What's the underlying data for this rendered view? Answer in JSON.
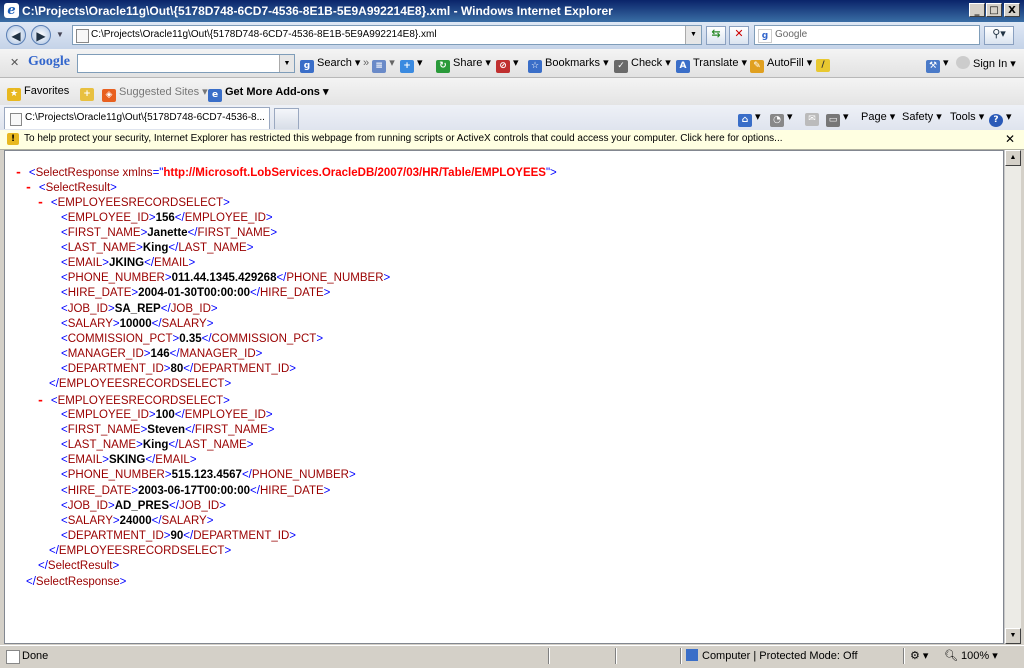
{
  "window": {
    "title": "C:\\Projects\\Oracle11g\\Out\\{5178D748-6CD7-4536-8E1B-5E9A992214E8}.xml - Windows Internet Explorer",
    "minimize": "_",
    "maximize": "□",
    "close": "X"
  },
  "address_bar": {
    "url": "C:\\Projects\\Oracle11g\\Out\\{5178D748-6CD7-4536-8E1B-5E9A992214E8}.xml",
    "search_placeholder": "Google"
  },
  "google_toolbar": {
    "brand": "Google",
    "items": [
      "Search",
      "Share",
      "Bookmarks",
      "Check",
      "Translate",
      "AutoFill"
    ],
    "sign_in": "Sign In"
  },
  "favorites_bar": {
    "favorites": "Favorites",
    "suggested_sites": "Suggested Sites",
    "get_addons": "Get More Add-ons"
  },
  "tab": {
    "title": "C:\\Projects\\Oracle11g\\Out\\{5178D748-6CD7-4536-8..."
  },
  "command_bar": {
    "page": "Page",
    "safety": "Safety",
    "tools": "Tools"
  },
  "info_bar": {
    "message": "To help protect your security, Internet Explorer has restricted this webpage from running scripts or ActiveX controls that could access your computer. Click here for options..."
  },
  "xml": {
    "root_tag": "SelectResponse",
    "root_attr_name": "xmlns",
    "root_attr_value": "http://Microsoft.LobServices.OracleDB/2007/03/HR/Table/EMPLOYEES",
    "result_tag": "SelectResult",
    "record_tag": "EMPLOYEESRECORDSELECT",
    "records": [
      {
        "fields": [
          {
            "tag": "EMPLOYEE_ID",
            "value": "156"
          },
          {
            "tag": "FIRST_NAME",
            "value": "Janette"
          },
          {
            "tag": "LAST_NAME",
            "value": "King"
          },
          {
            "tag": "EMAIL",
            "value": "JKING"
          },
          {
            "tag": "PHONE_NUMBER",
            "value": "011.44.1345.429268"
          },
          {
            "tag": "HIRE_DATE",
            "value": "2004-01-30T00:00:00"
          },
          {
            "tag": "JOB_ID",
            "value": "SA_REP"
          },
          {
            "tag": "SALARY",
            "value": "10000"
          },
          {
            "tag": "COMMISSION_PCT",
            "value": "0.35"
          },
          {
            "tag": "MANAGER_ID",
            "value": "146"
          },
          {
            "tag": "DEPARTMENT_ID",
            "value": "80"
          }
        ]
      },
      {
        "fields": [
          {
            "tag": "EMPLOYEE_ID",
            "value": "100"
          },
          {
            "tag": "FIRST_NAME",
            "value": "Steven"
          },
          {
            "tag": "LAST_NAME",
            "value": "King"
          },
          {
            "tag": "EMAIL",
            "value": "SKING"
          },
          {
            "tag": "PHONE_NUMBER",
            "value": "515.123.4567"
          },
          {
            "tag": "HIRE_DATE",
            "value": "2003-06-17T00:00:00"
          },
          {
            "tag": "JOB_ID",
            "value": "AD_PRES"
          },
          {
            "tag": "SALARY",
            "value": "24000"
          },
          {
            "tag": "DEPARTMENT_ID",
            "value": "90"
          }
        ]
      }
    ]
  },
  "status_bar": {
    "status": "Done",
    "zone": "Computer | Protected Mode: Off",
    "zoom": "100%"
  }
}
